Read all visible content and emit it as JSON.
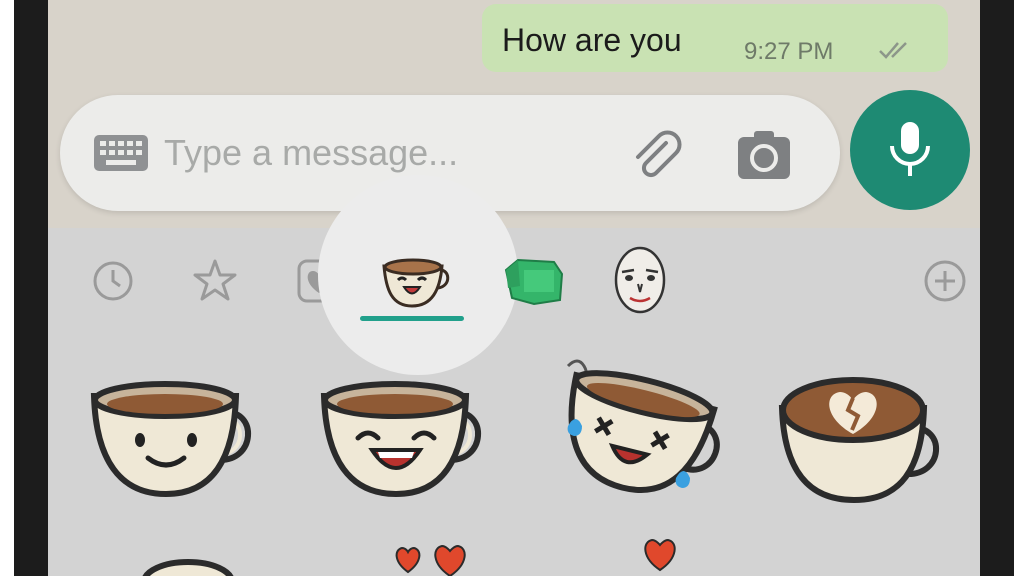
{
  "chat": {
    "message": {
      "text": "How are you",
      "time": "9:27 PM",
      "status_icon": "double-check-icon"
    }
  },
  "composer": {
    "placeholder": "Type a message...",
    "value": "",
    "left_icon": "keyboard-icon",
    "attach_icon": "paperclip-icon",
    "camera_icon": "camera-icon",
    "send_icon": "microphone-icon"
  },
  "sticker_tabs": [
    {
      "icon": "recent-clock-icon"
    },
    {
      "icon": "favorites-star-icon"
    },
    {
      "icon": "heart-icon"
    },
    {
      "icon": "coffee-cup-pack-icon",
      "selected": true
    },
    {
      "icon": "green-monster-pack-icon"
    },
    {
      "icon": "face-pack-icon"
    },
    {
      "icon": "add-stickers-icon"
    }
  ],
  "stickers": [
    {
      "icon": "coffee-cup-smile-sticker"
    },
    {
      "icon": "coffee-cup-laugh-sticker"
    },
    {
      "icon": "coffee-cup-dizzy-sticker"
    },
    {
      "icon": "coffee-cup-broken-heart-sticker"
    },
    {
      "icon": "cup-sticker"
    },
    {
      "icon": "hearts-sticker"
    },
    {
      "icon": "heart-sticker"
    }
  ],
  "colors": {
    "accent": "#1e8a73",
    "tab_indicator": "#21a08b",
    "outgoing_bubble": "#c9e2b3",
    "chat_background": "#d8d3ca",
    "panel_background": "#d3d3d3"
  }
}
